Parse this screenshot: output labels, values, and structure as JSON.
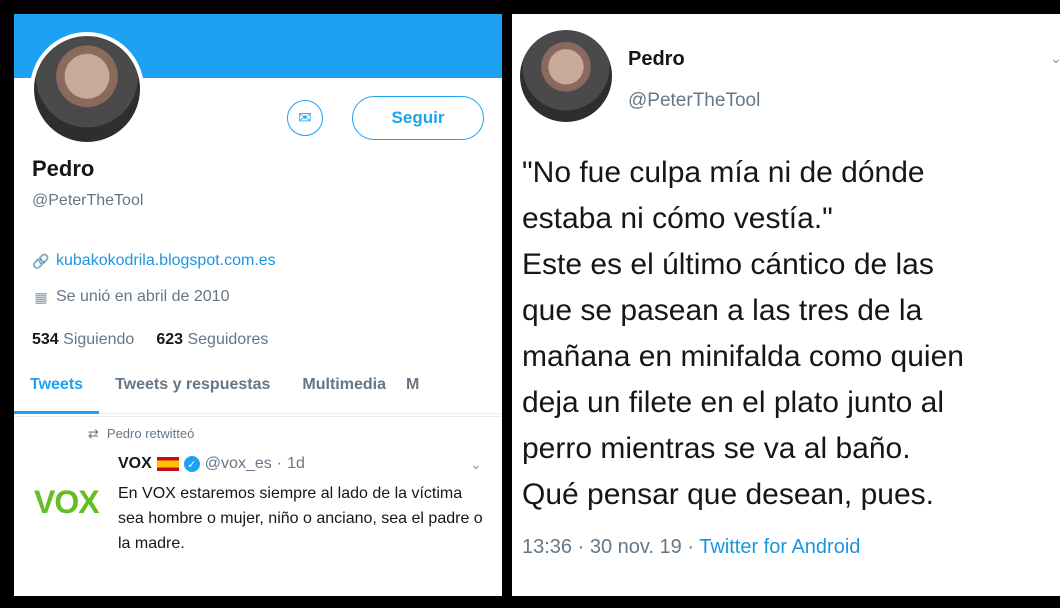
{
  "profile": {
    "name": "Pedro",
    "handle": "@PeterTheTool",
    "follow_label": "Seguir",
    "website": "kubakokodrila.blogspot.com.es",
    "joined": "Se unió en abril de 2010",
    "following_count": "534",
    "following_label": "Siguiendo",
    "followers_count": "623",
    "followers_label": "Seguidores",
    "tabs": [
      "Tweets",
      "Tweets y respuestas",
      "Multimedia",
      "M"
    ],
    "active_tab": "Tweets",
    "icons": {
      "message": "envelope-icon",
      "link": "link-icon",
      "calendar": "calendar-icon"
    }
  },
  "retweet": {
    "retweet_label": "Pedro retwitteó",
    "author_name": "VOX",
    "author_handle": "@vox_es",
    "time": "1d",
    "logo_text": "VOX",
    "text": "En VOX estaremos siempre al lado de la víctima sea hombre o mujer, niño o anciano, sea el padre o la madre."
  },
  "tweet": {
    "name": "Pedro",
    "handle": "@PeterTheTool",
    "lines": [
      "\"No fue culpa mía ni de dónde",
      "estaba ni cómo vestía.\"",
      "Este es el último cántico de las",
      "que se pasean a las tres de la",
      "mañana en minifalda como quien",
      "deja un filete en el plato junto al",
      "perro mientras se va al baño.",
      "Qué pensar que desean, pues."
    ],
    "time": "13:36",
    "date": "30 nov. 19",
    "source": "Twitter for Android"
  },
  "colors": {
    "accent": "#1da1f2",
    "vox_green": "#63be21",
    "muted": "#657786"
  }
}
